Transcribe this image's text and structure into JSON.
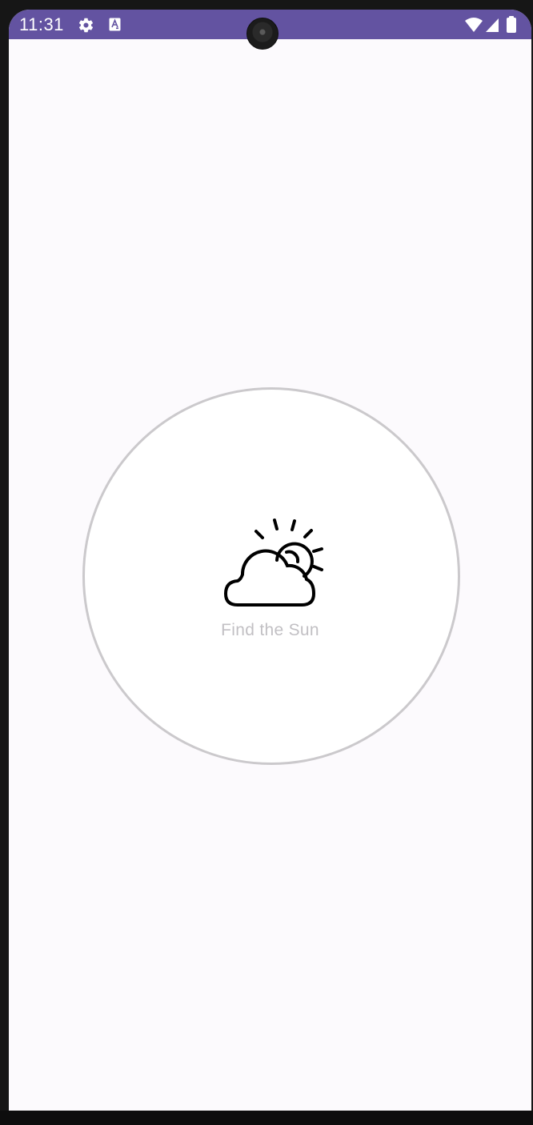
{
  "status_bar": {
    "time": "11:31",
    "icons": [
      "gear-icon",
      "text-a-icon",
      "wifi-icon",
      "signal-icon",
      "battery-icon"
    ],
    "color": "#6353a1"
  },
  "main": {
    "button_label": "Find the Sun",
    "button_icon": "partly-cloudy-icon",
    "label_color": "#c2c0c4",
    "ring_color": "#cbc9cc",
    "background": "#fcfafd"
  }
}
